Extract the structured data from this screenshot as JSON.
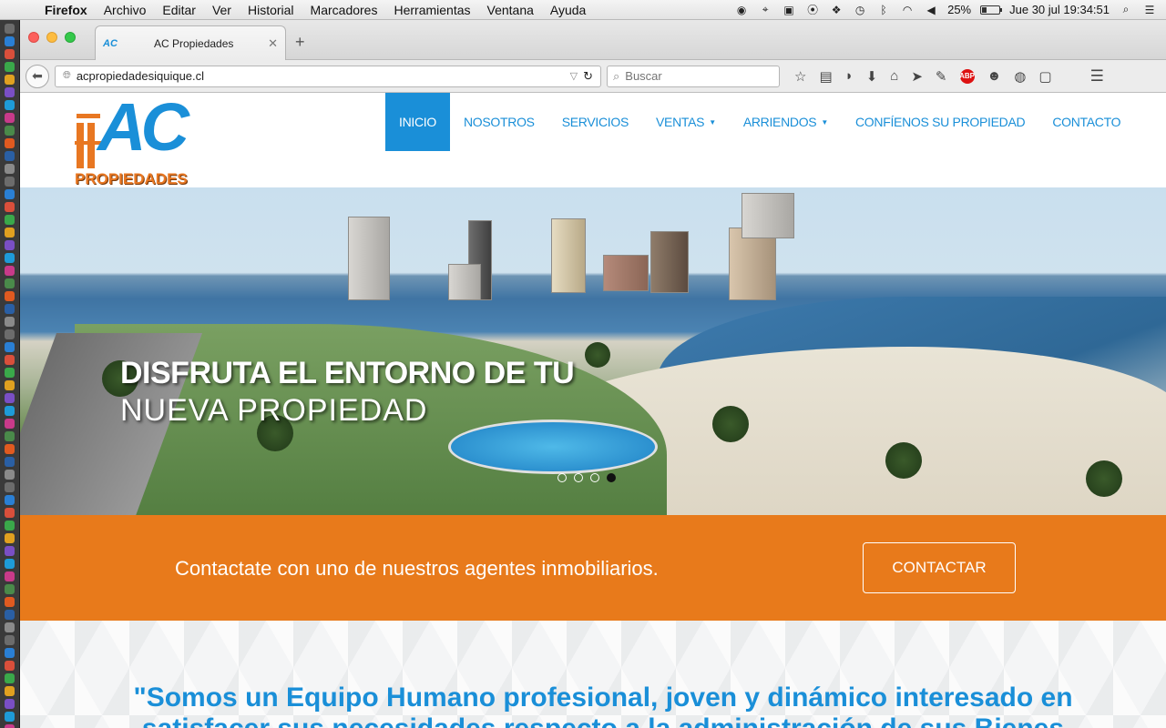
{
  "menubar": {
    "app": "Firefox",
    "items": [
      "Archivo",
      "Editar",
      "Ver",
      "Historial",
      "Marcadores",
      "Herramientas",
      "Ventana",
      "Ayuda"
    ],
    "battery": "25%",
    "battery_level": 0.25,
    "datetime": "Jue 30 jul  19:34:51"
  },
  "browser": {
    "tab_title": "AC Propiedades",
    "tab_favicon": "AC",
    "url": "acpropiedadesiquique.cl",
    "search_placeholder": "Buscar"
  },
  "site": {
    "logo": {
      "mark": "AC",
      "subtitle": "PROPIEDADES"
    },
    "nav": [
      {
        "label": "INICIO",
        "active": true
      },
      {
        "label": "NOSOTROS"
      },
      {
        "label": "SERVICIOS"
      },
      {
        "label": "VENTAS",
        "dropdown": true
      },
      {
        "label": "ARRIENDOS",
        "dropdown": true
      },
      {
        "label": "CONFÍENOS SU PROPIEDAD"
      },
      {
        "label": "CONTACTO"
      }
    ],
    "hero": {
      "line1": "DISFRUTA EL ENTORNO DE TU",
      "line2": "NUEVA PROPIEDAD",
      "slides": 4,
      "active_slide": 4
    },
    "cta": {
      "text": "Contactate con uno de nuestros agentes inmobiliarios.",
      "button": "CONTACTAR"
    },
    "quote": "\"Somos un Equipo Humano profesional, joven y dinámico interesado en satisfacer sus necesidades respecto a la administración de sus Bienes"
  },
  "colors": {
    "brand_blue": "#1a8fd8",
    "brand_orange": "#e87a1b"
  }
}
